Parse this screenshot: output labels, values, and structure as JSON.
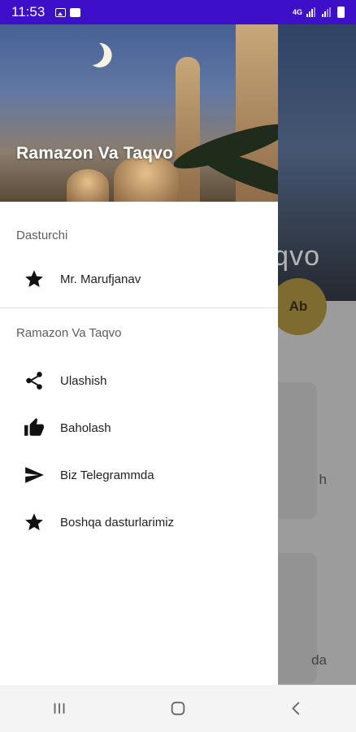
{
  "status_bar": {
    "time": "11:53",
    "network": "4G"
  },
  "background_app": {
    "title_fragment": "qvo",
    "avatar_text": "Ab",
    "card_texts": [
      "h",
      "da"
    ]
  },
  "drawer": {
    "header_title": "Ramazon Va Taqvo",
    "sections": [
      {
        "label": "Dasturchi",
        "items": [
          {
            "label": "Mr. Marufjanav",
            "icon": "star-icon"
          }
        ]
      },
      {
        "label": "Ramazon Va Taqvo",
        "items": [
          {
            "label": "Ulashish",
            "icon": "share-icon"
          },
          {
            "label": "Baholash",
            "icon": "thumb-up-icon"
          },
          {
            "label": "Biz Telegrammda",
            "icon": "send-icon"
          },
          {
            "label": "Boshqa dasturlarimiz",
            "icon": "star-icon"
          }
        ]
      }
    ]
  },
  "nav_bar": {
    "buttons": [
      "recents-icon",
      "home-icon",
      "back-icon"
    ]
  },
  "colors": {
    "status_bar": "#3d0fc9",
    "avatar": "#a1893e"
  }
}
